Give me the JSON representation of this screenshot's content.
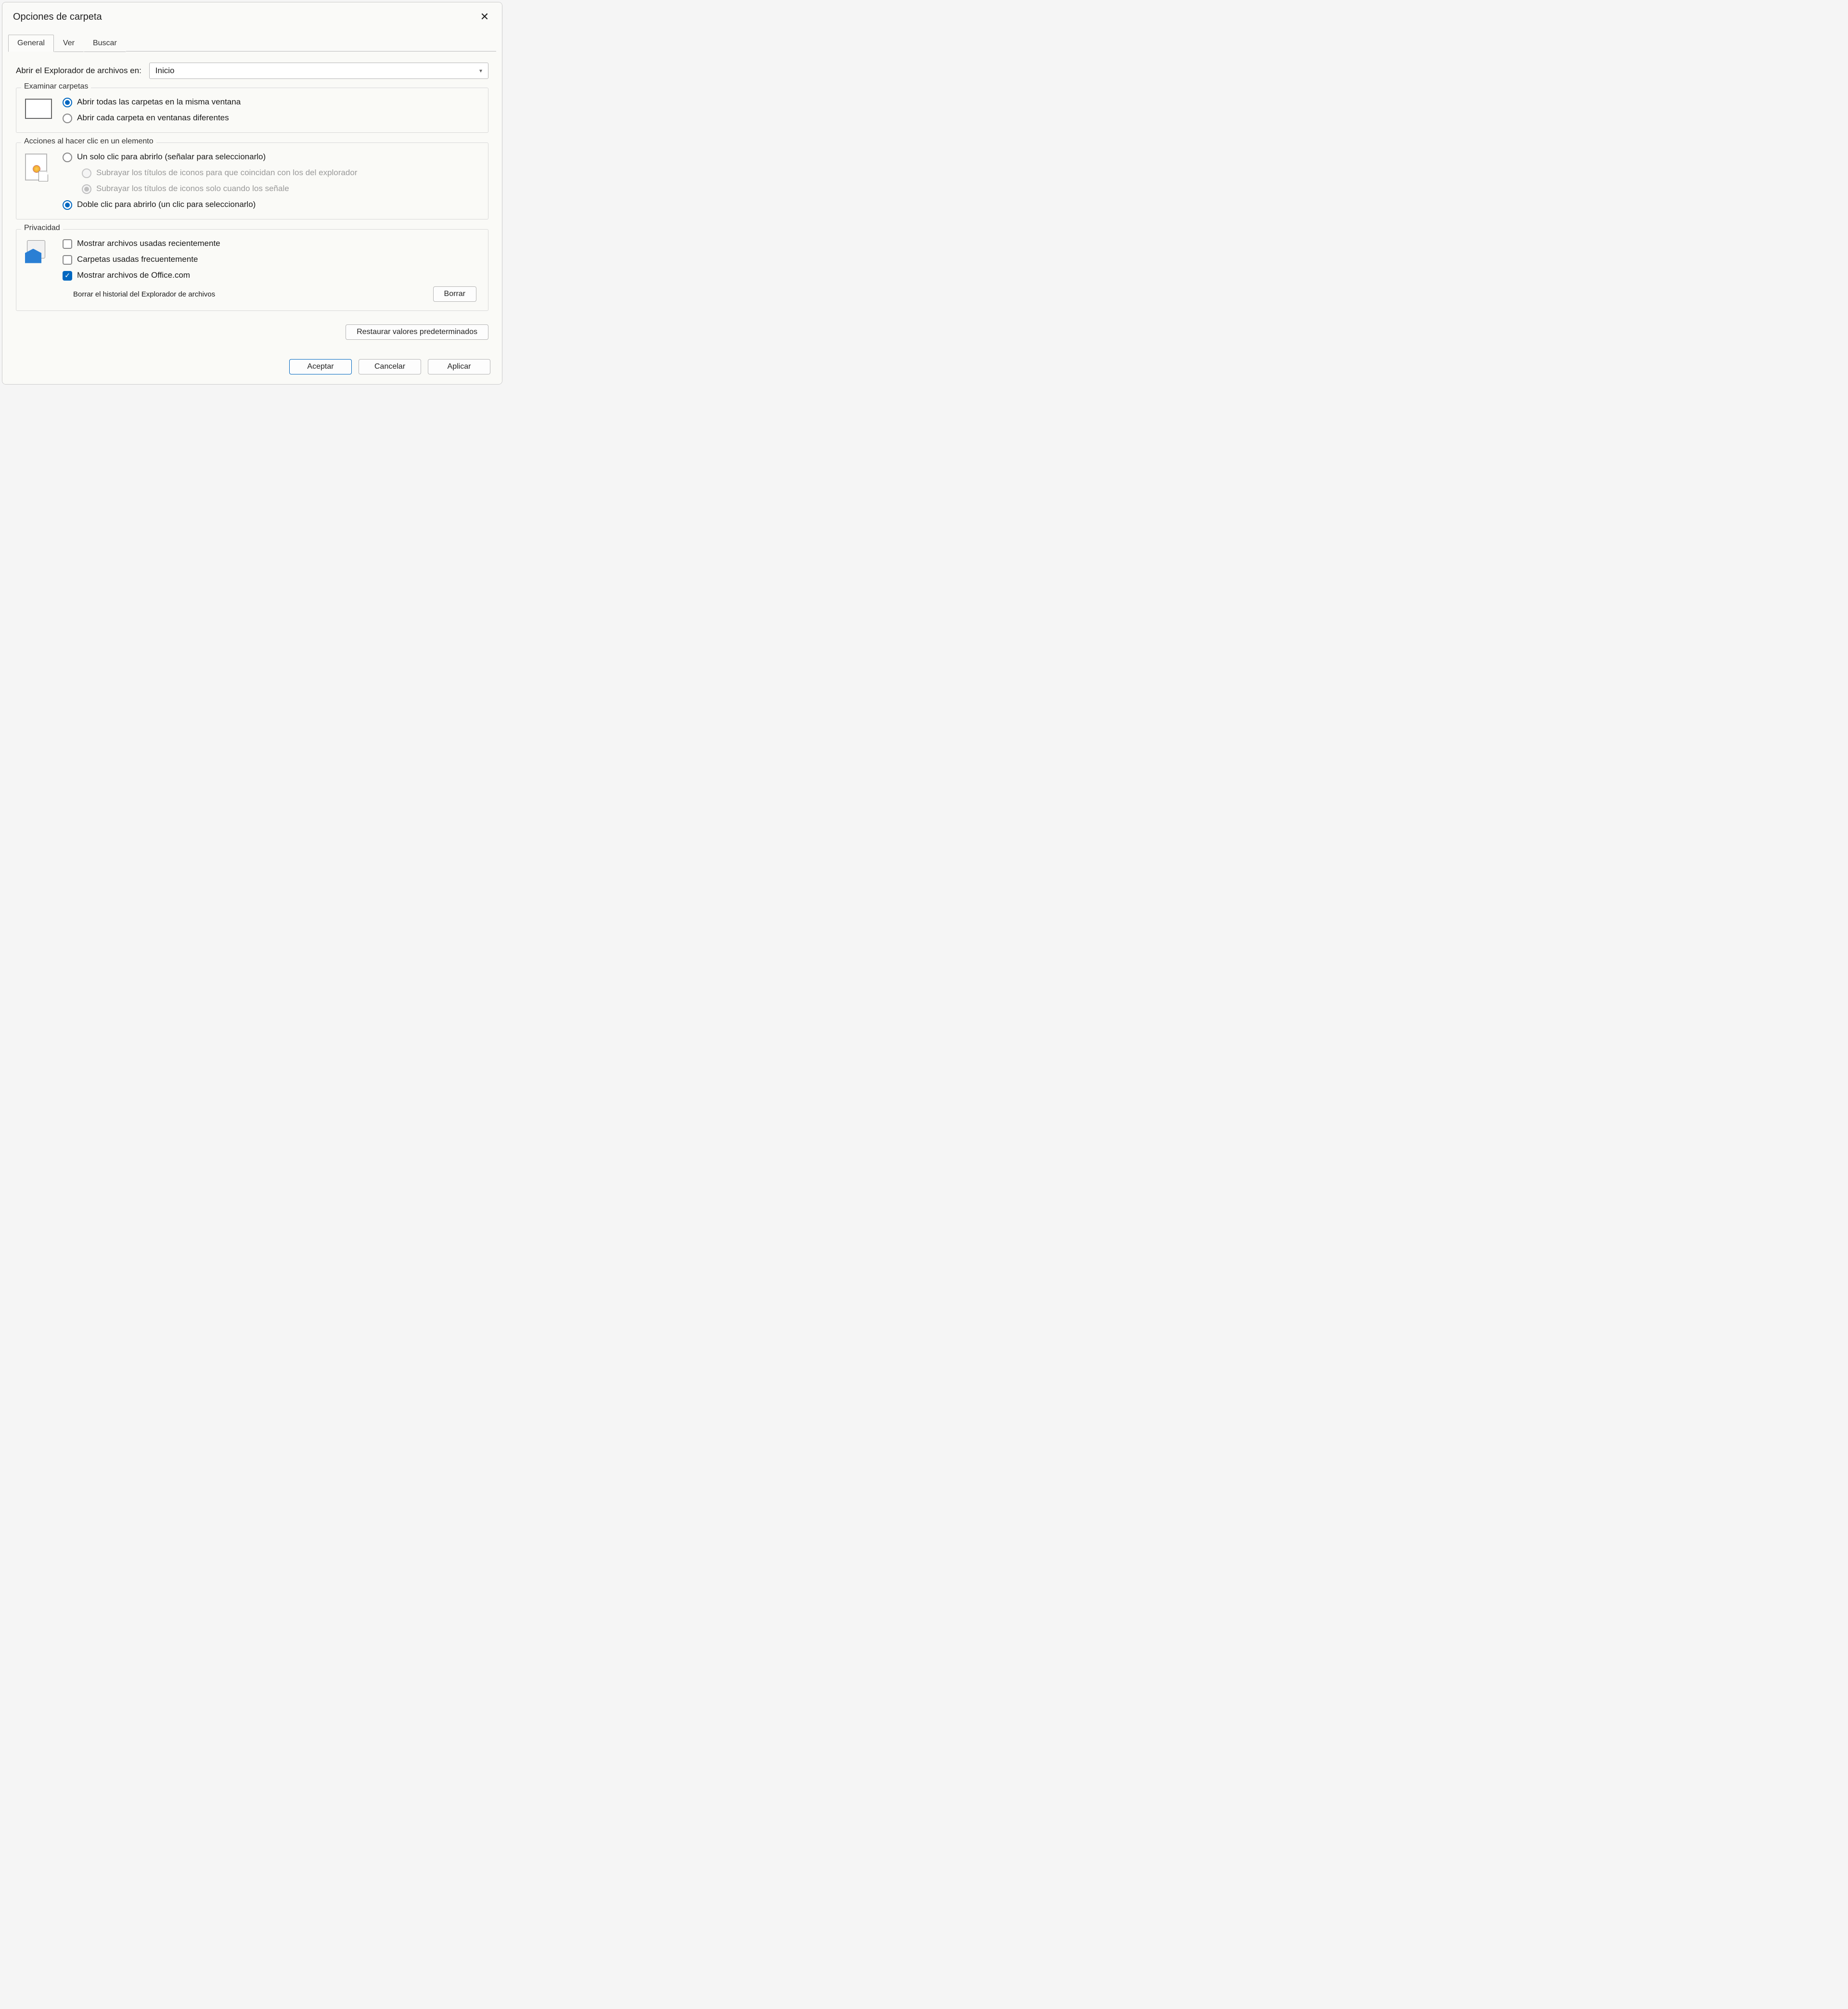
{
  "title": "Opciones de carpeta",
  "tabs": [
    "General",
    "Ver",
    "Buscar"
  ],
  "open_explorer": {
    "label": "Abrir el Explorador de archivos en:",
    "value": "Inicio"
  },
  "browse": {
    "legend": "Examinar carpetas",
    "opt_same": "Abrir todas las carpetas en la misma ventana",
    "opt_diff": "Abrir cada carpeta en ventanas diferentes"
  },
  "click": {
    "legend": "Acciones al hacer clic en un elemento",
    "opt_single": "Un solo clic para abrirlo (señalar para seleccionarlo)",
    "opt_underline_browser": "Subrayar los títulos de iconos para que coincidan con los del explorador",
    "opt_underline_point": "Subrayar los títulos de iconos solo cuando los señale",
    "opt_double": "Doble clic para abrirlo (un clic para seleccionarlo)"
  },
  "privacy": {
    "legend": "Privacidad",
    "chk_recent": "Mostrar archivos usadas recientemente",
    "chk_frequent": "Carpetas usadas frecuentemente",
    "chk_office": "Mostrar archivos de Office.com",
    "clear_label": "Borrar el historial del Explorador de archivos",
    "clear_btn": "Borrar"
  },
  "restore_btn": "Restaurar valores predeterminados",
  "footer": {
    "ok": "Aceptar",
    "cancel": "Cancelar",
    "apply": "Aplicar"
  }
}
